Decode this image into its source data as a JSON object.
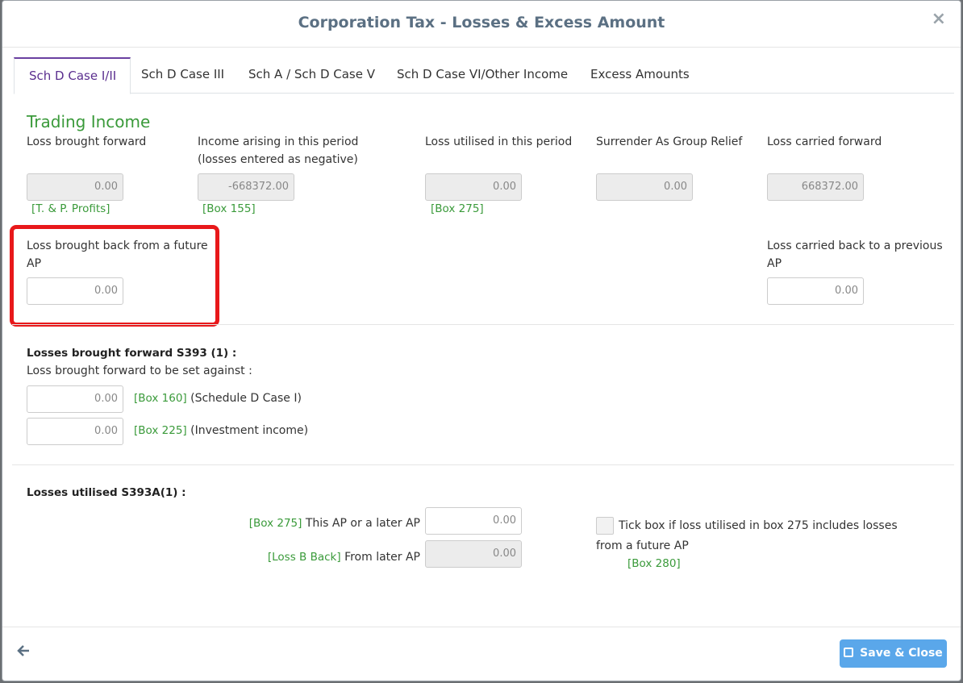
{
  "title": "Corporation Tax - Losses & Excess Amount",
  "close_icon": "×",
  "tabs": [
    "Sch D Case I/II",
    "Sch D Case III",
    "Sch A / Sch D Case V",
    "Sch D Case VI/Other Income",
    "Excess Amounts"
  ],
  "trading": {
    "heading": "Trading Income",
    "loss_bf_label": "Loss brought forward",
    "income_label_1": "Income arising in this period",
    "income_label_2": "(losses entered as negative)",
    "utilised_label": "Loss utilised in this period",
    "surrender_label": "Surrender As Group Relief",
    "carried_fwd_label": "Loss carried forward",
    "loss_bf_value": "0.00",
    "income_value": "-668372.00",
    "utilised_value": "0.00",
    "surrender_value": "0.00",
    "carried_fwd_value": "668372.00",
    "box_tp": "[T. & P. Profits]",
    "box_155": "[Box 155]",
    "box_275": "[Box 275]",
    "future_ap_label_1": "Loss brought back from a future",
    "future_ap_label_2": "AP",
    "future_ap_value": "0.00",
    "carried_back_label_1": "Loss carried back to a previous",
    "carried_back_label_2": "AP",
    "carried_back_value": "0.00"
  },
  "s393": {
    "heading": "Losses brought forward S393 (1) :",
    "sub": "Loss brought forward to be set against  :",
    "row1_value": "0.00",
    "row1_box": "[Box 160]",
    "row1_text": "(Schedule D Case I)",
    "row2_value": "0.00",
    "row2_box": "[Box 225]",
    "row2_text": "(Investment income)"
  },
  "s393a": {
    "heading": "Losses utilised S393A(1) :",
    "row1_box": "[Box 275]",
    "row1_text": "This AP or a later AP",
    "row1_value": "0.00",
    "row2_box": "[Loss B Back]",
    "row2_text": "From later AP",
    "row2_value": "0.00",
    "tick_text_1": "Tick box if loss utilised in box 275 includes losses",
    "tick_text_2": "from a future AP",
    "tick_box": "[Box 280]"
  },
  "footer": {
    "back_icon": "🡐",
    "save_label": "Save & Close"
  },
  "colors": {
    "accent_green": "#3a9a3a",
    "tab_purple": "#5b2f8f",
    "save_blue": "#5aa7ea",
    "highlight_red": "#e8181a"
  }
}
